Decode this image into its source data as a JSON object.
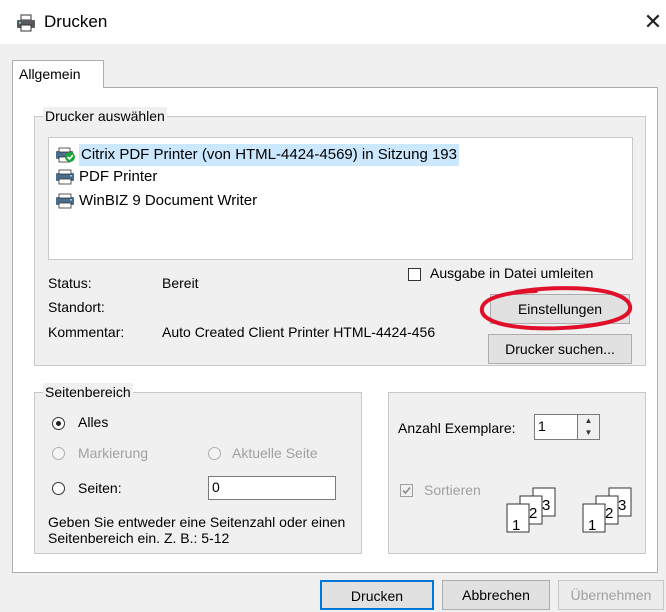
{
  "window": {
    "title": "Drucken",
    "close_glyph": "✕",
    "icon": "printer-icon"
  },
  "tabs": [
    {
      "label": "Allgemein",
      "active": true
    }
  ],
  "printer_group": {
    "legend": "Drucker auswählen",
    "printers": [
      {
        "name": "Citrix PDF Printer (von HTML-4424-4569) in Sitzung 193",
        "selected": true,
        "icon": "default-printer-icon"
      },
      {
        "name": "PDF Printer",
        "selected": false,
        "icon": "printer-icon"
      },
      {
        "name": "WinBIZ 9 Document Writer",
        "selected": false,
        "icon": "printer-icon"
      }
    ],
    "status_label": "Status:",
    "status_value": "Bereit",
    "location_label": "Standort:",
    "location_value": "",
    "comment_label": "Kommentar:",
    "comment_value": "Auto Created Client Printer HTML-4424-456",
    "print_to_file_label": "Ausgabe in Datei umleiten",
    "print_to_file_checked": false,
    "settings_button": "Einstellungen",
    "find_printer_button": "Drucker suchen..."
  },
  "page_range": {
    "legend": "Seitenbereich",
    "all_label": "Alles",
    "selection_label": "Markierung",
    "current_page_label": "Aktuelle Seite",
    "pages_label": "Seiten:",
    "pages_value": "0",
    "selected": "all",
    "hint": "Geben Sie entweder eine Seitenzahl oder einen Seitenbereich ein. Z. B.: 5-12"
  },
  "copies": {
    "label": "Anzahl Exemplare:",
    "value": "1",
    "collate_label": "Sortieren",
    "collate_checked": true,
    "collate_pages": [
      "1",
      "2",
      "3"
    ]
  },
  "buttons": {
    "print": "Drucken",
    "cancel": "Abbrechen",
    "apply": "Übernehmen"
  },
  "colors": {
    "selection": "#cce8ff",
    "annotation": "#e0102a",
    "window_bg": "#f0f0f0"
  }
}
